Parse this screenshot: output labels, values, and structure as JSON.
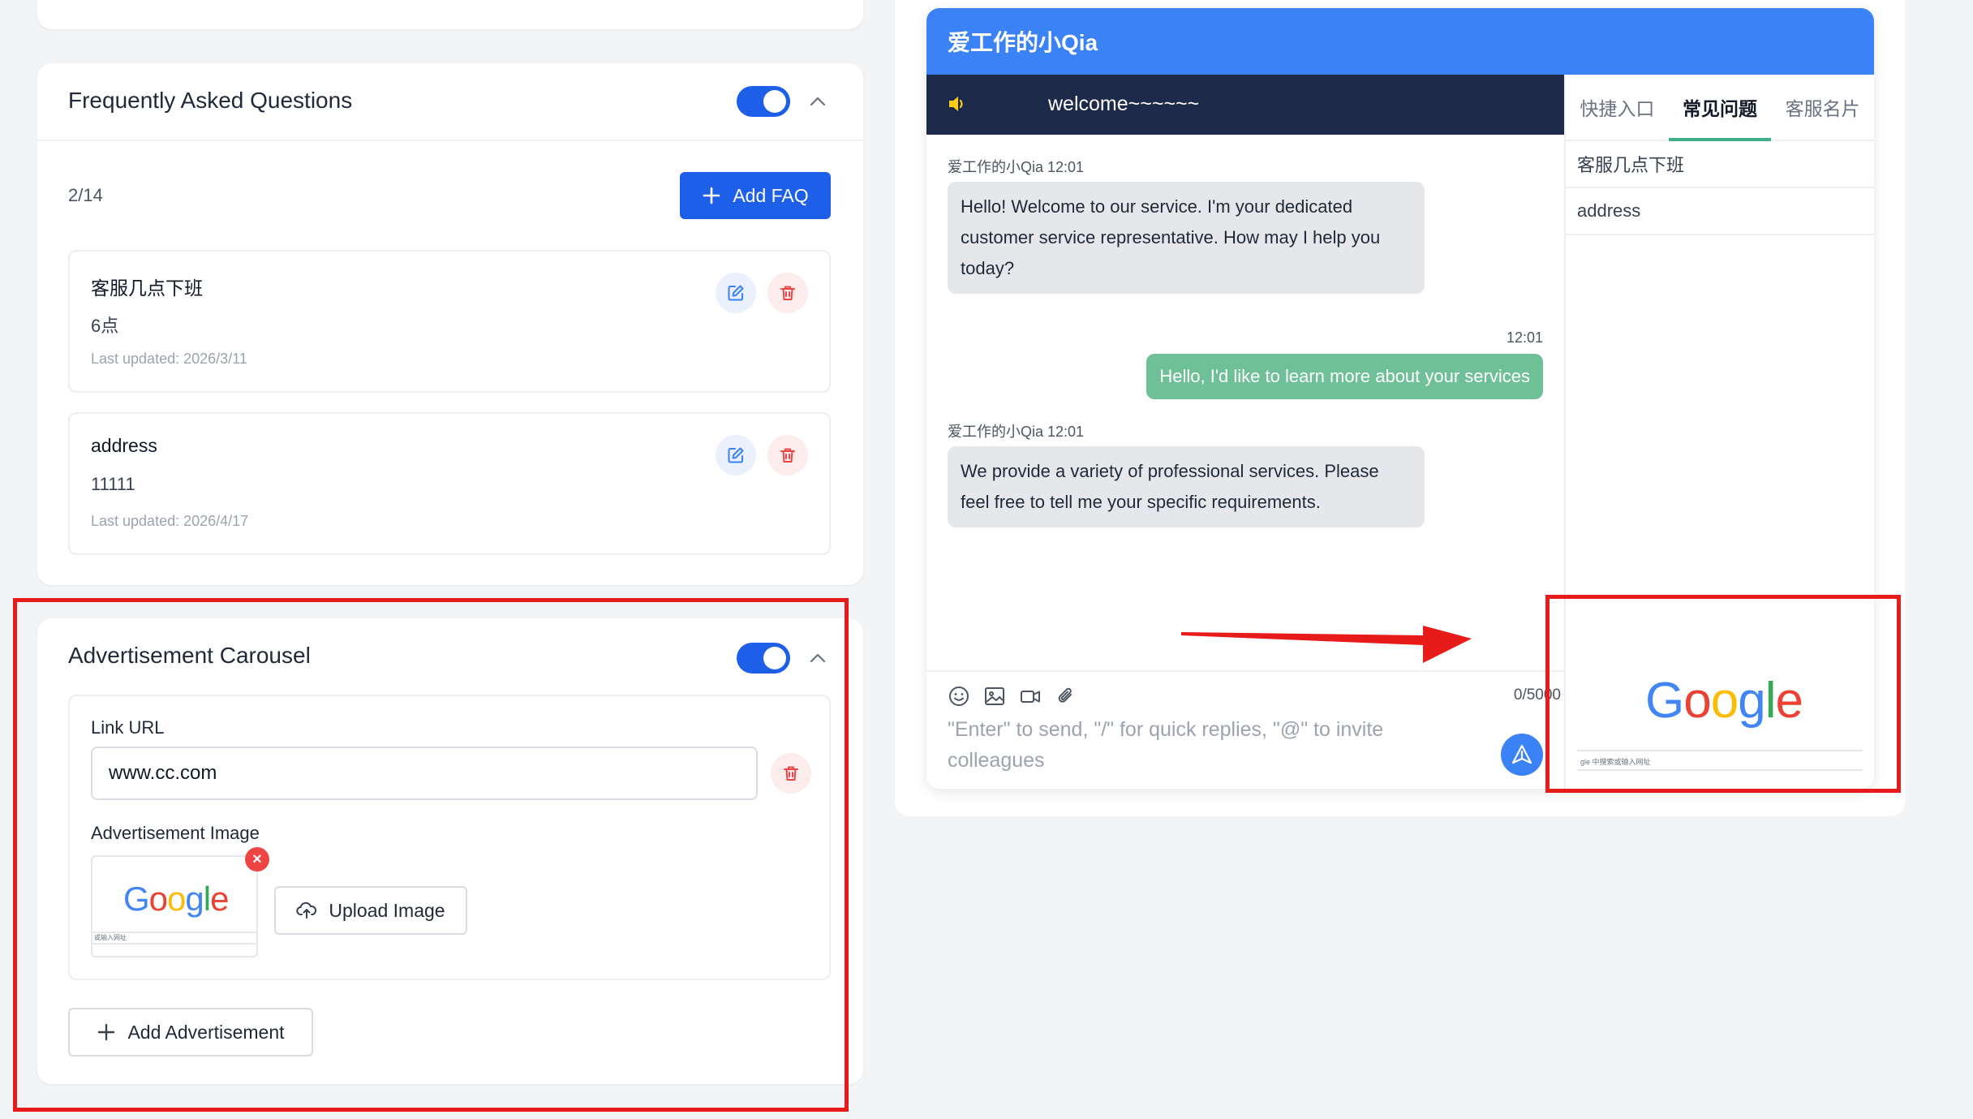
{
  "faq": {
    "title": "Frequently Asked Questions",
    "count": "2/14",
    "add_label": "Add FAQ",
    "items": [
      {
        "question": "客服几点下班",
        "answer": "6点",
        "updated": "Last updated: 2026/3/11"
      },
      {
        "question": "address",
        "answer": "11111",
        "updated": "Last updated: 2026/4/17"
      }
    ]
  },
  "ads": {
    "title": "Advertisement Carousel",
    "link_label": "Link URL",
    "link_value": "www.cc.com",
    "image_label": "Advertisement Image",
    "remove_symbol": "×",
    "upload_label": "Upload Image",
    "add_label": "Add Advertisement",
    "thumb_logo": "Google",
    "thumb_search_text": "或输入网址"
  },
  "preview": {
    "title": "爱工作的小Qia",
    "notice": "welcome~~~~~~",
    "tabs": [
      "快捷入口",
      "常见问题",
      "客服名片"
    ],
    "active_tab": 1,
    "faq_list": [
      "客服几点下班",
      "address"
    ],
    "messages": [
      {
        "sender": "爱工作的小Qia 12:01",
        "text": "Hello! Welcome to our service. I'm your dedicated customer service representative. How may I help you today?"
      },
      {
        "time": "12:01",
        "text": "Hello, I'd like to learn more about your services"
      },
      {
        "sender": "爱工作的小Qia 12:01",
        "text": "We provide a variety of professional services. Please feel free to tell me your specific requirements."
      }
    ],
    "char_count": "0/5000",
    "placeholder": "\"Enter\" to send, \"/\" for quick replies, \"@\" to invite colleagues",
    "ad_logo": "Google",
    "ad_search_text": "gle 中搜索或输入网址"
  },
  "colors": {
    "primary": "#1d5fe8",
    "header": "#3b82f6",
    "notice_bar": "#1e2a4a",
    "outgoing_bubble": "#6fbf97",
    "delete_red": "#ef4444",
    "highlight_red": "#e81b1b",
    "active_tab_underline": "#3dae8a"
  }
}
